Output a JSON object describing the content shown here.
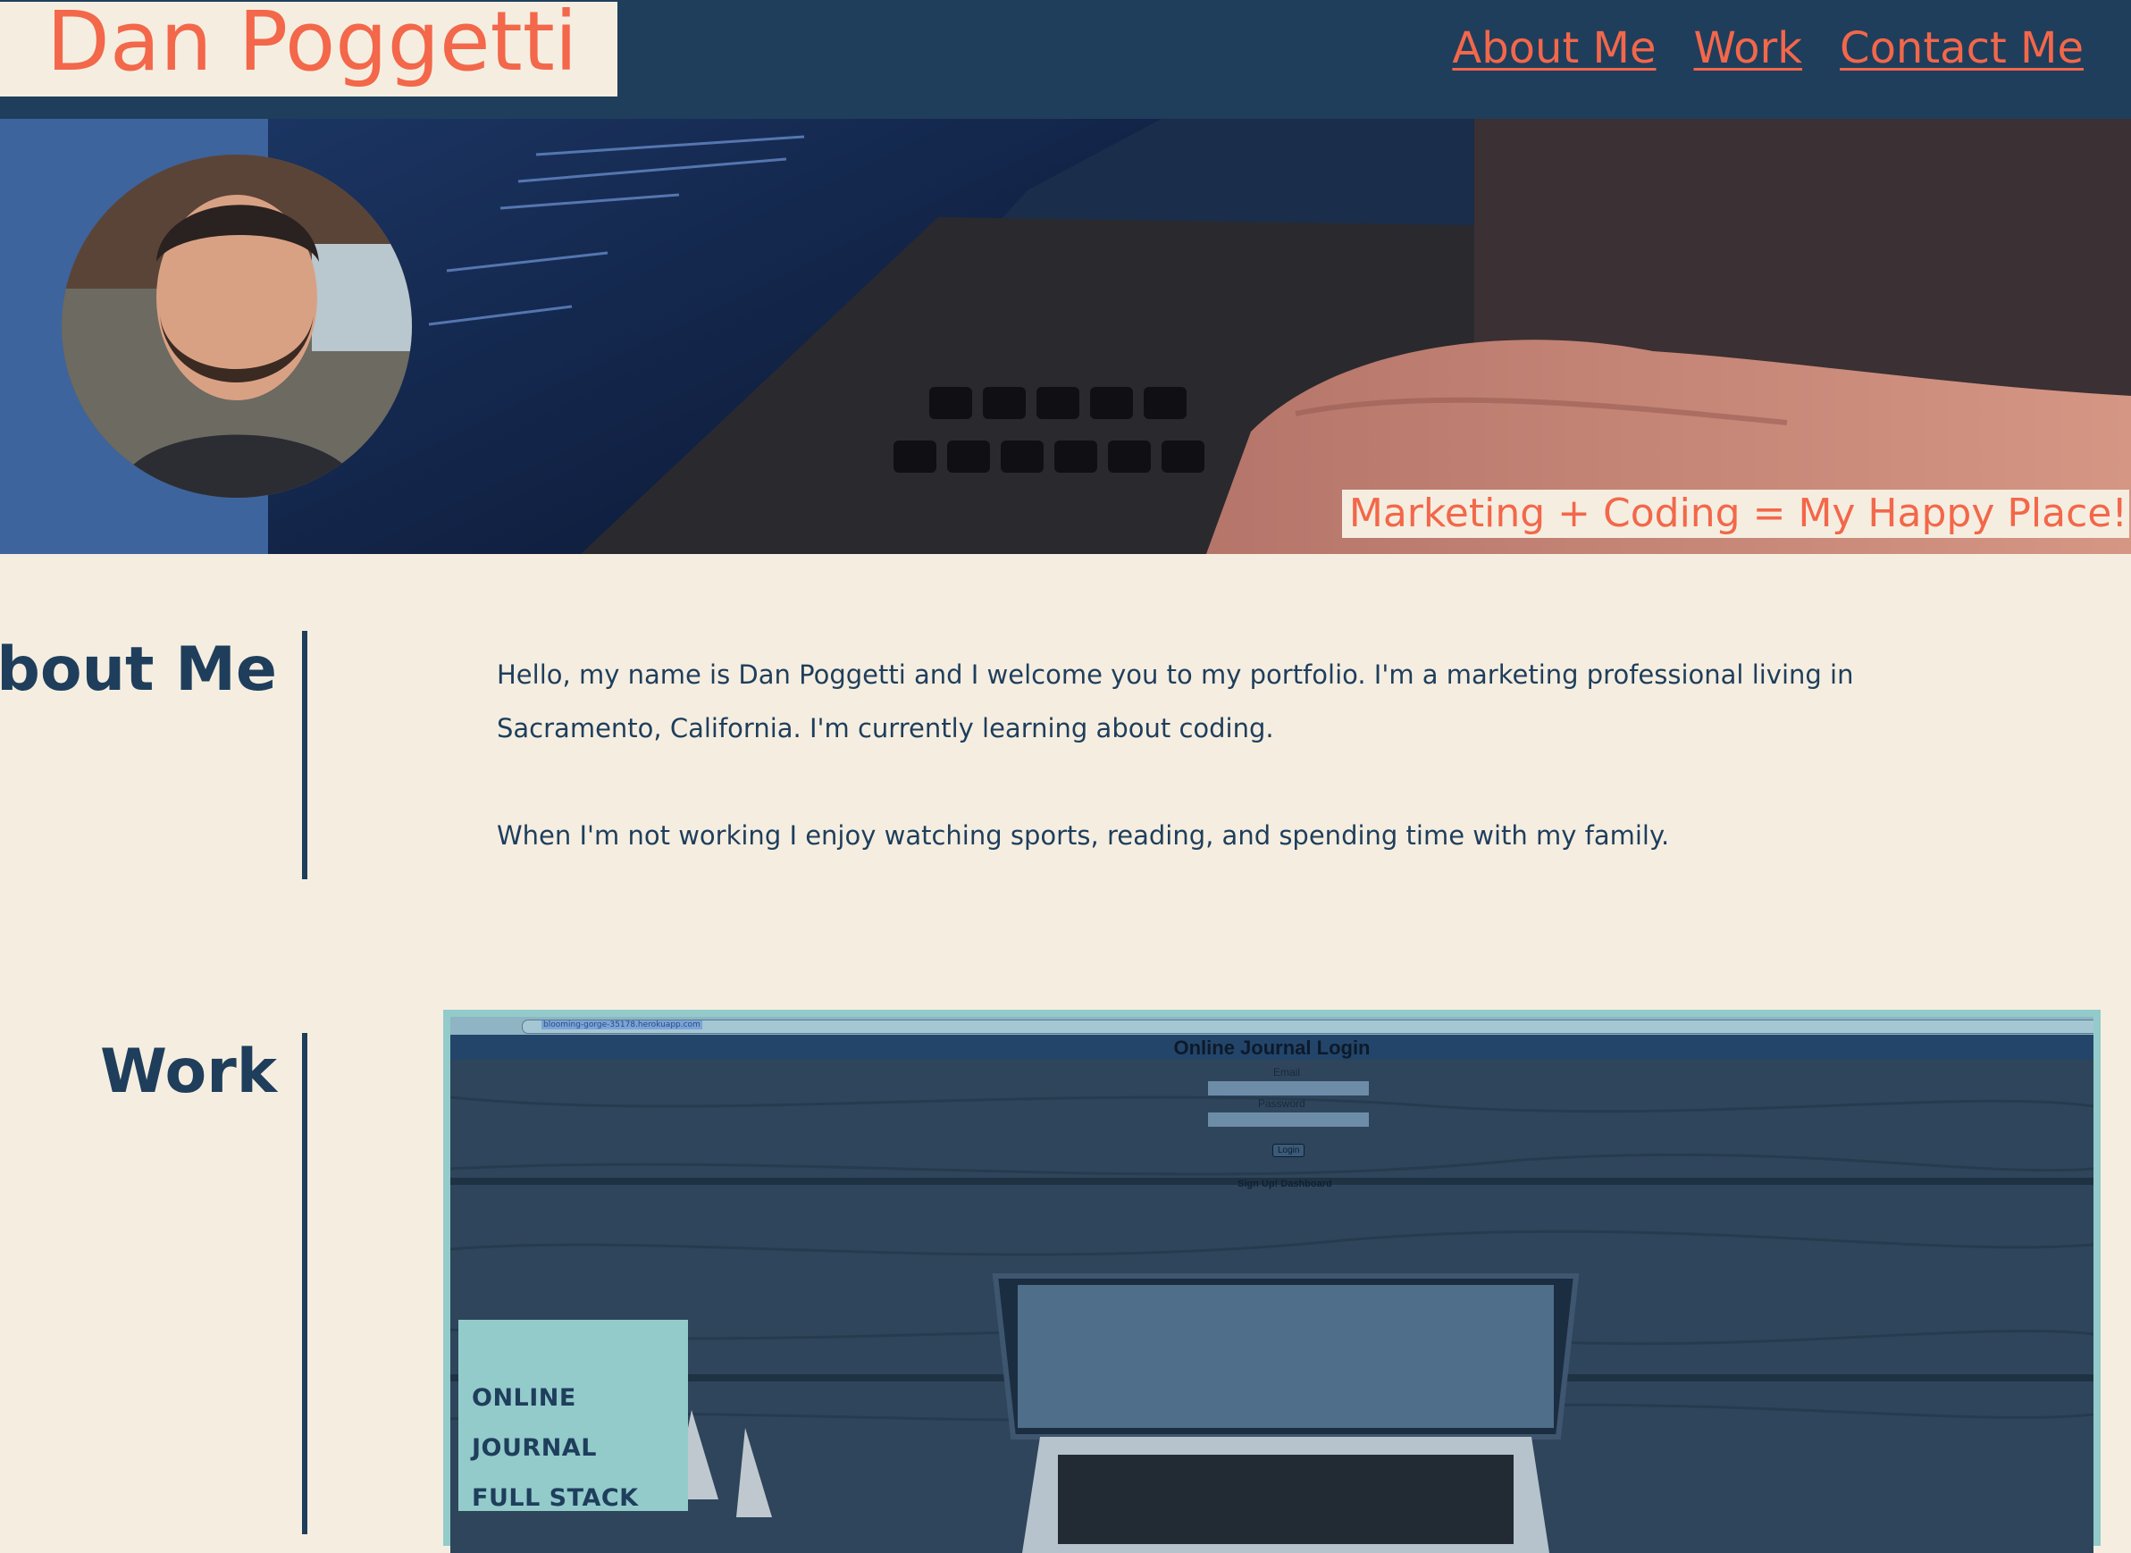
{
  "header": {
    "site_title": "Dan Poggetti",
    "nav": [
      {
        "label": "About Me"
      },
      {
        "label": "Work"
      },
      {
        "label": "Contact Me"
      }
    ]
  },
  "hero": {
    "tagline": "Marketing + Coding = My Happy Place!"
  },
  "about": {
    "heading": "About Me",
    "paragraphs": [
      "Hello, my name is Dan Poggetti and I welcome you to my portfolio. I'm a marketing professional living in Sacramento, California. I'm currently learning about coding.",
      "When I'm not working I enjoy watching sports, reading, and spending time with my family."
    ]
  },
  "work": {
    "heading": "Work",
    "projects": [
      {
        "label_line1": "ONLINE JOURNAL",
        "label_line2": "FULL STACK",
        "screenshot": {
          "url": "blooming-gorge-35178.herokuapp.com",
          "app_title": "Online Journal Login",
          "email_label": "Email",
          "password_label": "Password",
          "login_button": "Login",
          "links": "Sign Up! Dashboard"
        }
      }
    ]
  },
  "colors": {
    "navy": "#1f3e5c",
    "coral": "#f3674a",
    "cream": "#f5eee0",
    "teal": "#93cbcb"
  }
}
